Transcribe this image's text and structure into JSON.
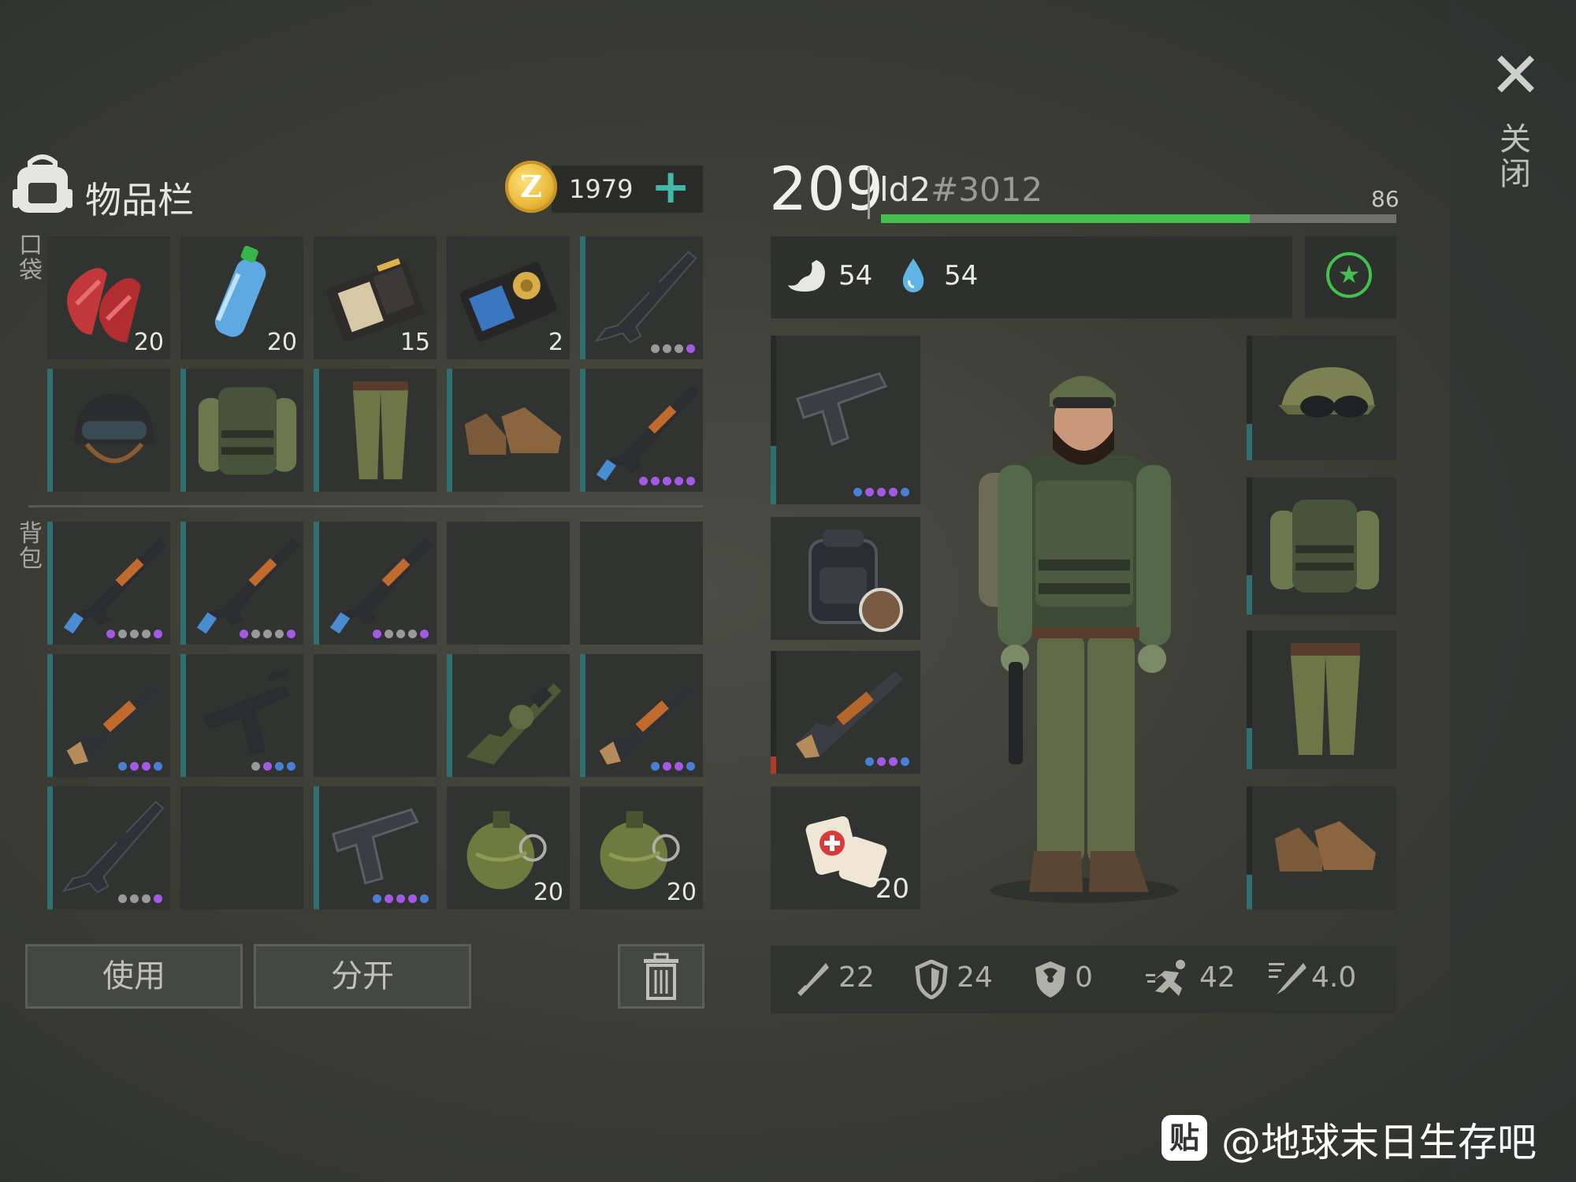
{
  "inventory": {
    "title": "物品栏",
    "coin_symbol": "Z",
    "coins": "1979",
    "add_label": "+",
    "pocket_label": "口袋",
    "backpack_label": "背包",
    "pocket_slots": [
      {
        "item": "raw-meat",
        "count": "20"
      },
      {
        "item": "water-bottle",
        "count": "20"
      },
      {
        "item": "patrol-officer-id",
        "count": "15"
      },
      {
        "item": "police-badge-wallet",
        "count": "2"
      },
      {
        "item": "m16-rifle",
        "dots": [
          "g",
          "g",
          "g",
          "p"
        ]
      },
      {
        "item": "combat-helmet"
      },
      {
        "item": "camo-vest"
      },
      {
        "item": "camo-pants"
      },
      {
        "item": "boots"
      },
      {
        "item": "ak47-rifle",
        "dots": [
          "p",
          "p",
          "p",
          "p",
          "p"
        ]
      }
    ],
    "backpack_slots": [
      {
        "item": "ak47-rifle",
        "dots": [
          "p",
          "g",
          "g",
          "g",
          "p"
        ]
      },
      {
        "item": "ak47-rifle",
        "dots": [
          "p",
          "g",
          "g",
          "g",
          "p"
        ]
      },
      {
        "item": "ak47-rifle",
        "dots": [
          "p",
          "g",
          "g",
          "g",
          "p"
        ]
      },
      {
        "item": "empty"
      },
      {
        "item": "empty"
      },
      {
        "item": "shotgun",
        "dots": [
          "b",
          "p",
          "p",
          "b"
        ]
      },
      {
        "item": "uzi",
        "dots": [
          "g",
          "p",
          "b",
          "b"
        ]
      },
      {
        "item": "empty"
      },
      {
        "item": "grenade-launcher"
      },
      {
        "item": "shotgun",
        "dots": [
          "b",
          "p",
          "p",
          "b"
        ]
      },
      {
        "item": "m16-rifle",
        "dots": [
          "g",
          "g",
          "g",
          "p"
        ]
      },
      {
        "item": "empty"
      },
      {
        "item": "pistol",
        "dots": [
          "b",
          "p",
          "p",
          "p",
          "b"
        ]
      },
      {
        "item": "grenade",
        "count": "20"
      },
      {
        "item": "grenade",
        "count": "20"
      }
    ],
    "use_button": "使用",
    "split_button": "分开"
  },
  "character": {
    "level": "209",
    "name": "ld2",
    "tag": "#3012",
    "xp_value": "86",
    "xp_fraction": 0.716,
    "food": "54",
    "water": "54",
    "left_equipment": [
      {
        "item": "pistol",
        "dots": [
          "b",
          "p",
          "p",
          "p",
          "b"
        ]
      },
      {
        "item": "backpack"
      },
      {
        "item": "shotgun",
        "dots": [
          "b",
          "p",
          "p",
          "b"
        ]
      },
      {
        "item": "bandage",
        "count": "20"
      }
    ],
    "right_equipment": [
      "cap",
      "camo-vest",
      "camo-pants",
      "boots"
    ],
    "stats": {
      "attack": "22",
      "defense": "24",
      "radiation": "0",
      "speed": "42",
      "stealth": "4.0"
    }
  },
  "close": {
    "icon": "close-icon",
    "label": "关闭"
  },
  "watermark": "@地球末日生存吧",
  "colors": {
    "accent_teal": "#2f6f70",
    "xp_green": "#44c04f",
    "purple_dot": "#a45ae6",
    "blue_dot": "#4a7fd6",
    "coin_gold": "#e9b93a"
  }
}
